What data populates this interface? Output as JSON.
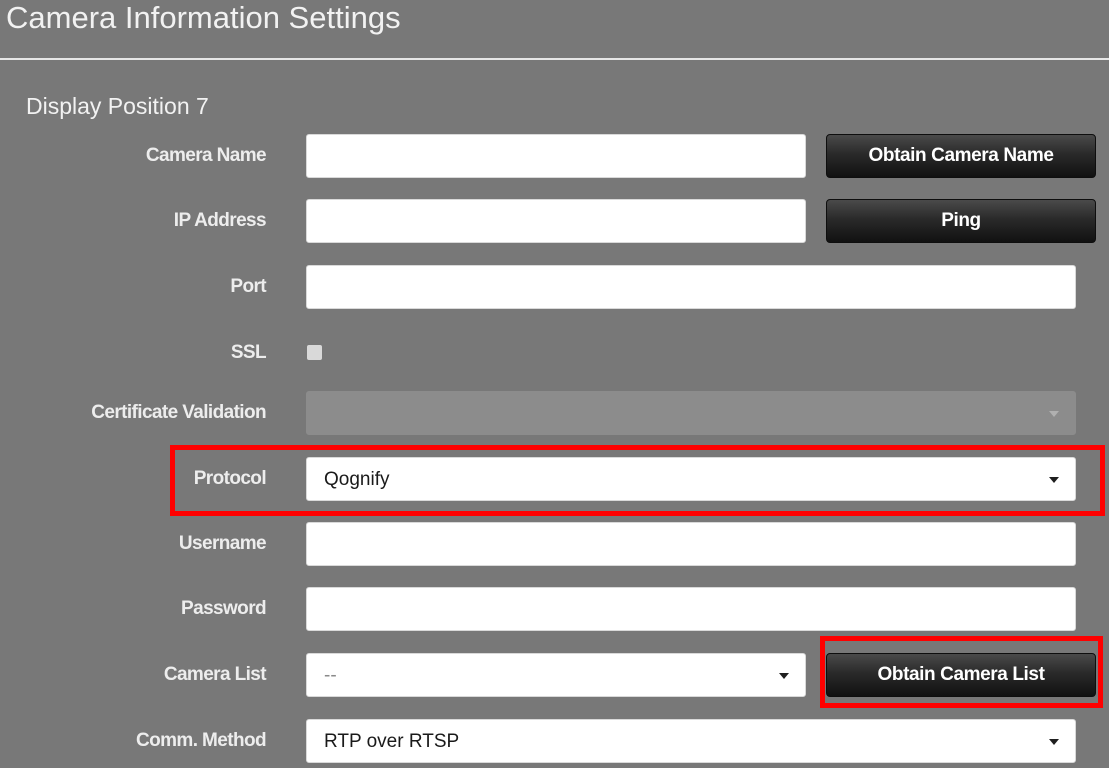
{
  "header": {
    "title": "Camera Information Settings"
  },
  "section": {
    "title": "Display Position 7"
  },
  "form": {
    "camera_name": {
      "label": "Camera Name",
      "value": "",
      "button_label": "Obtain Camera Name"
    },
    "ip_address": {
      "label": "IP Address",
      "value": "",
      "button_label": "Ping"
    },
    "port": {
      "label": "Port",
      "value": ""
    },
    "ssl": {
      "label": "SSL",
      "checked": false
    },
    "certificate_validation": {
      "label": "Certificate Validation",
      "value": "",
      "disabled": true
    },
    "protocol": {
      "label": "Protocol",
      "value": "Qognify"
    },
    "username": {
      "label": "Username",
      "value": ""
    },
    "password": {
      "label": "Password",
      "value": ""
    },
    "camera_list": {
      "label": "Camera List",
      "value": "--",
      "button_label": "Obtain Camera List"
    },
    "comm_method": {
      "label": "Comm. Method",
      "value": "RTP over RTSP"
    }
  },
  "colors": {
    "background": "#787878",
    "highlight": "#ff0000",
    "button_dark": "#1a1a1a"
  },
  "icons": {
    "dropdown": "caret-down-icon"
  }
}
